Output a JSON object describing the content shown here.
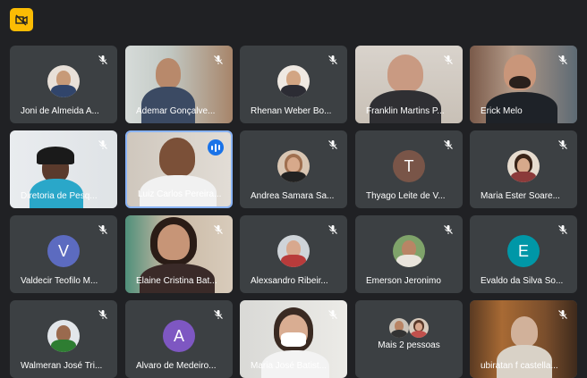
{
  "colors": {
    "background": "#202124",
    "tile": "#3c4043",
    "active_border": "#8ab4f8",
    "camera_button": "#fbbc04"
  },
  "toolbar": {
    "camera_button_icon": "camera-off-icon"
  },
  "participants": [
    {
      "name": "Joni de Almeida A...",
      "type": "photo-avatar",
      "muted": true
    },
    {
      "name": "Ademar Gonçalve...",
      "type": "video",
      "muted": true
    },
    {
      "name": "Rhenan Weber Bo...",
      "type": "photo-avatar",
      "muted": true
    },
    {
      "name": "Franklin Martins P...",
      "type": "video",
      "muted": true
    },
    {
      "name": "Erick Melo",
      "type": "video",
      "muted": true
    },
    {
      "name": "Diretoria de Pesq...",
      "type": "video",
      "muted": true
    },
    {
      "name": "Luiz Carlos Pereira...",
      "type": "video",
      "muted": false,
      "speaking": true
    },
    {
      "name": "Andrea Samara Sa...",
      "type": "photo-avatar",
      "muted": true
    },
    {
      "name": "Thyago Leite de V...",
      "type": "letter-avatar",
      "letter": "T",
      "avatar_color": "#795548",
      "muted": true
    },
    {
      "name": "Maria Ester Soare...",
      "type": "photo-avatar",
      "muted": true
    },
    {
      "name": "Valdecir Teofilo M...",
      "type": "letter-avatar",
      "letter": "V",
      "avatar_color": "#5c6bc0",
      "muted": true
    },
    {
      "name": "Elaine Cristina Bat...",
      "type": "video",
      "muted": true
    },
    {
      "name": "Alexsandro Ribeir...",
      "type": "photo-avatar",
      "muted": true
    },
    {
      "name": "Emerson Jeronimo",
      "type": "photo-avatar",
      "muted": true
    },
    {
      "name": "Evaldo da Silva So...",
      "type": "letter-avatar",
      "letter": "E",
      "avatar_color": "#0097a7",
      "muted": true
    },
    {
      "name": "Walmeran José Tri...",
      "type": "photo-avatar",
      "muted": true
    },
    {
      "name": "Alvaro de Medeiro...",
      "type": "letter-avatar",
      "letter": "A",
      "avatar_color": "#7e57c2",
      "muted": true
    },
    {
      "name": "Maria José Batist...",
      "type": "video",
      "muted": true
    },
    {
      "name": "Mais 2 pessoas",
      "type": "overflow",
      "muted": false
    },
    {
      "name": "ubiratan f castella...",
      "type": "video",
      "muted": true
    }
  ]
}
